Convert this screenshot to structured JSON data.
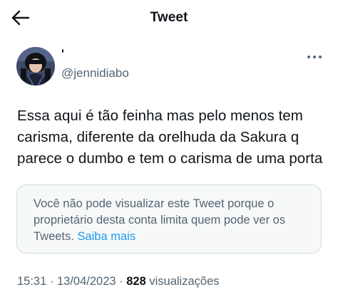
{
  "header": {
    "title": "Tweet",
    "back_icon": "arrow-left-icon"
  },
  "author": {
    "display_name": "'",
    "handle": "@jennidiabo",
    "avatar_icon": "profile-photo"
  },
  "more_icon": "more-horizontal-icon",
  "tweet": {
    "text": "Essa aqui é tão feinha mas pelo menos tem\ncarisma, diferente da orelhuda da Sakura q\nparece o dumbo e tem o carisma de uma porta"
  },
  "notice": {
    "text": "Você não pode visualizar este Tweet porque o proprietário desta conta limita quem pode ver os Tweets.",
    "link": "Saiba mais"
  },
  "meta": {
    "time": "15:31",
    "separator": " · ",
    "date": "13/04/2023",
    "views": "828",
    "views_label": "visualizações"
  },
  "colors": {
    "text": "#0f1419",
    "secondary": "#536471",
    "link": "#1d9bf0",
    "border": "#cfd9de",
    "notice_bg": "#f7f9f9"
  }
}
